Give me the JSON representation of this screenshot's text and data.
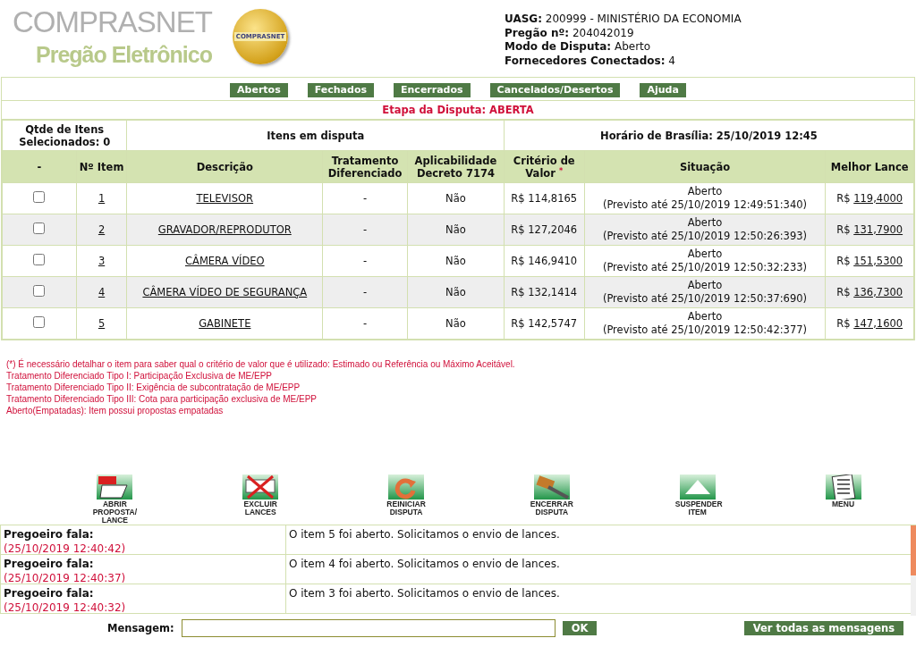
{
  "logo": {
    "title": "COMPRASNET",
    "subtitle": "Pregão Eletrônico",
    "badge": "COMPRASNET"
  },
  "info": [
    {
      "label": "UASG:",
      "value": "200999 - MINISTÉRIO DA ECONOMIA"
    },
    {
      "label": "Pregão nº:",
      "value": "204042019"
    },
    {
      "label": "Modo de Disputa:",
      "value": "Aberto"
    },
    {
      "label": "Fornecedores Conectados:",
      "value": "4"
    }
  ],
  "nav": [
    "Abertos",
    "Fechados",
    "Encerrados",
    "Cancelados/Desertos",
    "Ajuda"
  ],
  "stage": "Etapa da Disputa: ABERTA",
  "summary": {
    "selected": "Qtde de Itens Selecionados: 0",
    "title": "Itens em disputa",
    "clock": "Horário de Brasília: 25/10/2019 12:45"
  },
  "columns": [
    "-",
    "Nº Item",
    "Descrição",
    "Tratamento Diferenciado",
    "Aplicabilidade Decreto 7174",
    "Critério de Valor",
    "Situação",
    "Melhor Lance"
  ],
  "criterion_mark": "*",
  "rows": [
    {
      "checked": false,
      "item": "1",
      "description": "TELEVISOR",
      "treatment": "-",
      "decree": "Não",
      "value": "R$ 114,8165",
      "status": "Aberto",
      "forecast": "(Previsto até 25/10/2019 12:49:51:340)",
      "currency": "R$",
      "best": "119,4000"
    },
    {
      "checked": false,
      "item": "2",
      "description": "GRAVADOR/REPRODUTOR",
      "treatment": "-",
      "decree": "Não",
      "value": "R$ 127,2046",
      "status": "Aberto",
      "forecast": "(Previsto até 25/10/2019 12:50:26:393)",
      "currency": "R$",
      "best": "131,7900"
    },
    {
      "checked": false,
      "item": "3",
      "description": "CÂMERA VÍDEO",
      "treatment": "-",
      "decree": "Não",
      "value": "R$ 146,9410",
      "status": "Aberto",
      "forecast": "(Previsto até 25/10/2019 12:50:32:233)",
      "currency": "R$",
      "best": "151,5300"
    },
    {
      "checked": false,
      "item": "4",
      "description": "CÂMERA VÍDEO DE SEGURANÇA",
      "treatment": "-",
      "decree": "Não",
      "value": "R$ 132,1414",
      "status": "Aberto",
      "forecast": "(Previsto até 25/10/2019 12:50:37:690)",
      "currency": "R$",
      "best": "136,7300"
    },
    {
      "checked": false,
      "item": "5",
      "description": "GABINETE",
      "treatment": "-",
      "decree": "Não",
      "value": "R$ 142,5747",
      "status": "Aberto",
      "forecast": "(Previsto até 25/10/2019 12:50:42:377)",
      "currency": "R$",
      "best": "147,1600"
    }
  ],
  "notes": [
    "(*) É necessário detalhar o item para saber qual o critério de valor que é utilizado: Estimado ou Referência ou Máximo Aceitável.",
    "Tratamento Diferenciado Tipo I: Participação Exclusiva de ME/EPP",
    "Tratamento Diferenciado Tipo II: Exigência de subcontratação de ME/EPP",
    "Tratamento Diferenciado Tipo III: Cota para participação exclusiva de ME/EPP",
    "Aberto(Empatadas): Item possui propostas empatadas"
  ],
  "actions": [
    {
      "kind": "open",
      "label": "ABRIR PROPOSTA/ LANCE"
    },
    {
      "kind": "delete",
      "label": "EXCLUIR LANCES"
    },
    {
      "kind": "restart",
      "label": "REINICIAR DISPUTA"
    },
    {
      "kind": "close",
      "label": "ENCERRAR DISPUTA"
    },
    {
      "kind": "suspend",
      "label": "SUSPENDER ITEM"
    },
    {
      "kind": "menu",
      "label": "MENU"
    }
  ],
  "messages": [
    {
      "sender": "Pregoeiro fala:",
      "time": "(25/10/2019 12:40:42)",
      "text": "O item 5 foi aberto. Solicitamos o envio de lances."
    },
    {
      "sender": "Pregoeiro fala:",
      "time": "(25/10/2019 12:40:37)",
      "text": "O item 4 foi aberto. Solicitamos o envio de lances."
    },
    {
      "sender": "Pregoeiro fala:",
      "time": "(25/10/2019 12:40:32)",
      "text": "O item 3 foi aberto. Solicitamos o envio de lances."
    }
  ],
  "composer": {
    "label": "Mensagem:",
    "send": "OK",
    "all": "Ver todas as mensagens"
  }
}
